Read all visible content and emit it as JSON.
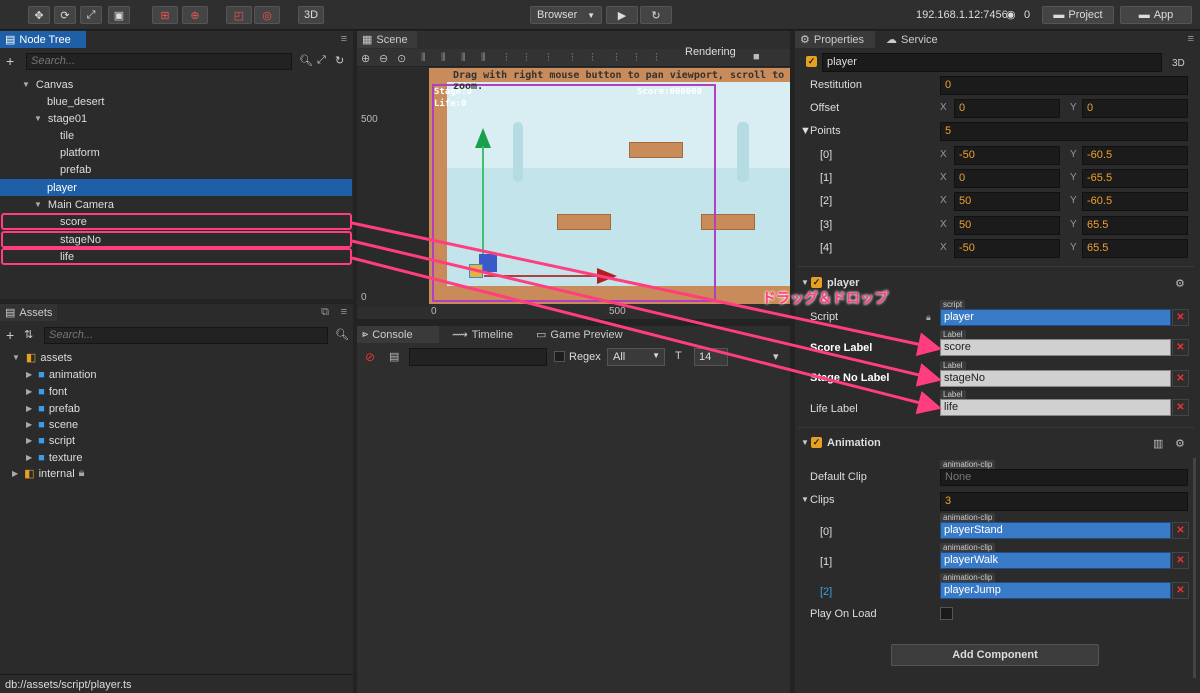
{
  "toolbar": {
    "btn_3d": "3D",
    "browser": "Browser",
    "ip": "192.168.1.12:7456",
    "wifi_count": "0",
    "project": "Project",
    "app": "App"
  },
  "node_tree": {
    "tab": "Node Tree",
    "search_placeholder": "Search...",
    "items": [
      {
        "label": "Canvas"
      },
      {
        "label": "blue_desert"
      },
      {
        "label": "stage01"
      },
      {
        "label": "tile"
      },
      {
        "label": "platform"
      },
      {
        "label": "prefab"
      },
      {
        "label": "player"
      },
      {
        "label": "Main Camera"
      },
      {
        "label": "score"
      },
      {
        "label": "stageNo"
      },
      {
        "label": "life"
      }
    ]
  },
  "assets": {
    "tab": "Assets",
    "search_placeholder": "Search...",
    "items": [
      {
        "label": "assets"
      },
      {
        "label": "animation"
      },
      {
        "label": "font"
      },
      {
        "label": "prefab"
      },
      {
        "label": "scene"
      },
      {
        "label": "script"
      },
      {
        "label": "texture"
      },
      {
        "label": "internal"
      }
    ]
  },
  "status_bar": "db://assets/script/player.ts",
  "scene": {
    "tab": "Scene",
    "rendering": "Rendering",
    "hint": "Drag with right mouse button to pan viewport, scroll to zoom.",
    "ruler_500_y": "500",
    "ruler_0_y": "0",
    "ruler_0_x": "0",
    "ruler_500_x": "500",
    "game_stage": "Stage:0",
    "game_life": "Life:0",
    "game_score": "Score:000000"
  },
  "console": {
    "tab": "Console",
    "tab2": "Timeline",
    "tab3": "Game Preview",
    "regex": "Regex",
    "filter": "All",
    "font_size": "14"
  },
  "annotation": "ドラッグ＆ドロップ",
  "properties": {
    "tab": "Properties",
    "tab2": "Service",
    "node_name": "player",
    "btn_3d": "3D",
    "restitution_label": "Restitution",
    "restitution": "0",
    "offset_label": "Offset",
    "offset_x": "0",
    "offset_y": "0",
    "points_label": "Points",
    "points_count": "5",
    "points": [
      {
        "idx": "[0]",
        "x": "-50",
        "y": "-60.5"
      },
      {
        "idx": "[1]",
        "x": "0",
        "y": "-65.5"
      },
      {
        "idx": "[2]",
        "x": "50",
        "y": "-60.5"
      },
      {
        "idx": "[3]",
        "x": "50",
        "y": "65.5"
      },
      {
        "idx": "[4]",
        "x": "-50",
        "y": "65.5"
      }
    ],
    "comp_player": "player",
    "script_label": "Script",
    "script_tag": "script",
    "script_value": "player",
    "score_label": "Score Label",
    "score_value": "score",
    "label_tag": "Label",
    "stage_label": "Stage No Label",
    "stage_value": "stageNo",
    "life_label": "Life Label",
    "life_value": "life",
    "comp_anim": "Animation",
    "default_clip_label": "Default Clip",
    "clip_tag": "animation-clip",
    "default_clip": "None",
    "clips_label": "Clips",
    "clips_count": "3",
    "clips": [
      {
        "idx": "[0]",
        "value": "playerStand"
      },
      {
        "idx": "[1]",
        "value": "playerWalk"
      },
      {
        "idx": "[2]",
        "value": "playerJump"
      }
    ],
    "play_on_load": "Play On Load",
    "add_component": "Add Component"
  },
  "colors": {
    "accent": "#e8a020",
    "highlight": "#ff3d7f",
    "selected": "#1f5fa8"
  }
}
